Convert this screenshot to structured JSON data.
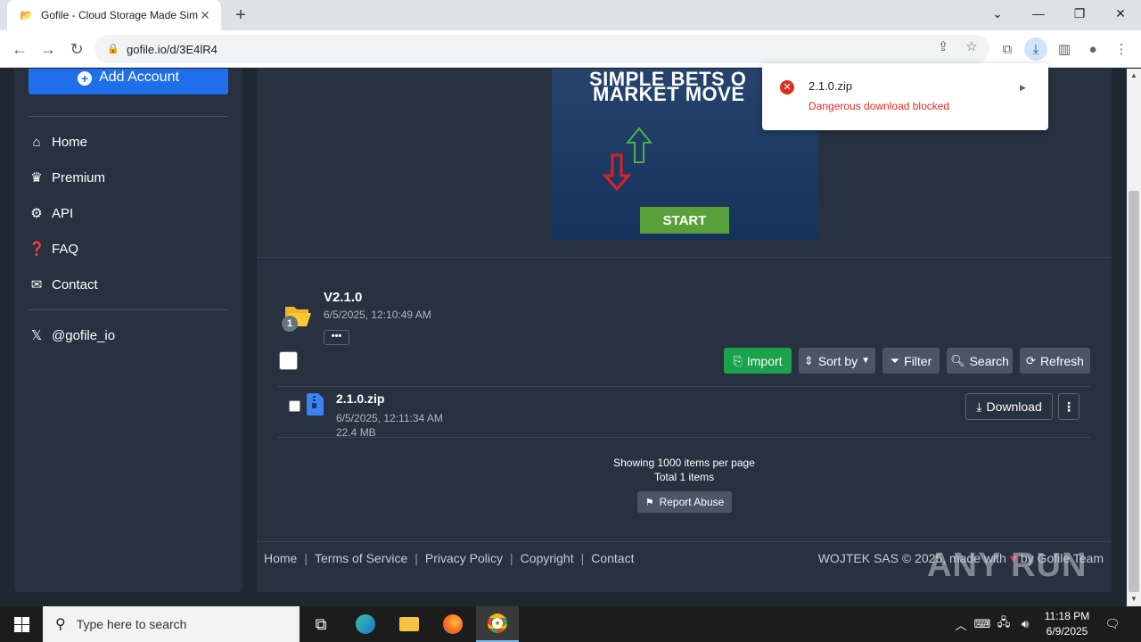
{
  "browser": {
    "tab_title": "Gofile - Cloud Storage Made Sim",
    "tab_close": "✕",
    "new_tab": "+",
    "url": "gofile.io/d/3E4lR4",
    "download_item": {
      "filename": "2.1.0.zip",
      "status": "Dangerous download blocked"
    }
  },
  "sidebar": {
    "add_account": "Add Account",
    "items": [
      {
        "label": "Home",
        "icon": "home-icon"
      },
      {
        "label": "Premium",
        "icon": "crown-icon"
      },
      {
        "label": "API",
        "icon": "cogs-icon"
      },
      {
        "label": "FAQ",
        "icon": "question-icon"
      },
      {
        "label": "Contact",
        "icon": "envelope-icon"
      }
    ],
    "social": {
      "label": "@gofile_io",
      "icon": "x-logo-icon"
    }
  },
  "ad": {
    "line1": "SIMPLE BETS O",
    "line2": "MARKET MOVE",
    "cta": "START"
  },
  "folder": {
    "name": "V2.1.0",
    "date": "6/5/2025, 12:10:49 AM",
    "count": "1",
    "more": "•••"
  },
  "actions": {
    "import": "Import",
    "sort": "Sort by",
    "filter": "Filter",
    "search": "Search",
    "refresh": "Refresh"
  },
  "files": [
    {
      "name": "2.1.0.zip",
      "date": "6/5/2025, 12:11:34 AM",
      "size": "22.4 MB",
      "download": "Download"
    }
  ],
  "pagination": {
    "per_page": "Showing 1000 items per page",
    "total": "Total 1 items",
    "report": "Report Abuse"
  },
  "footer": {
    "links": [
      "Home",
      "Terms of Service",
      "Privacy Policy",
      "Copyright",
      "Contact"
    ],
    "copyright": "WOJTEK SAS © 2025, made with",
    "by": "by Gofile Team"
  },
  "watermark": "ANY RUN",
  "taskbar": {
    "search_placeholder": "Type here to search",
    "time": "11:18 PM",
    "date": "6/9/2025"
  },
  "colors": {
    "page_bg": "#1f2732",
    "panel_bg": "#283140",
    "accent_blue": "#1f6feb",
    "import_green": "#1aa34a",
    "error_red": "#d93025"
  }
}
